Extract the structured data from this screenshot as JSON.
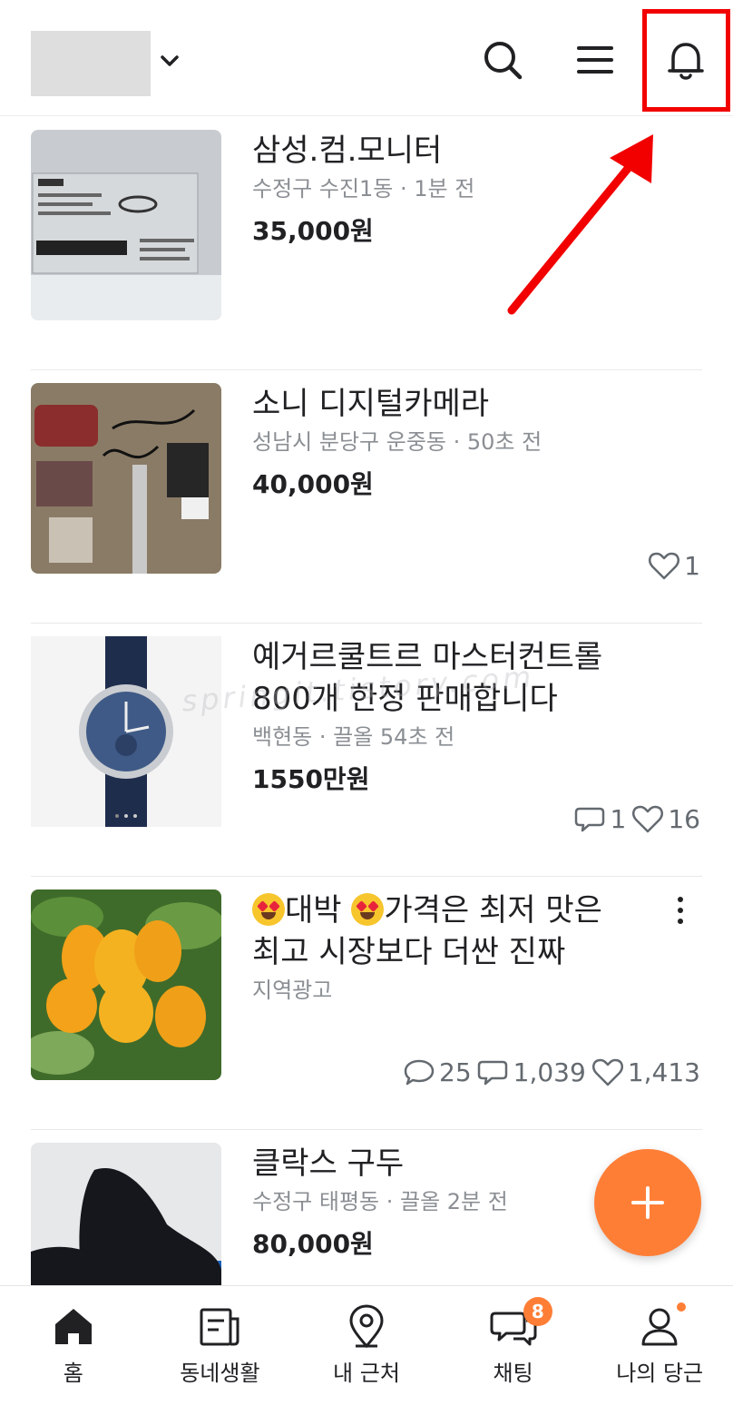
{
  "header": {
    "icons": [
      "chevron-down-icon",
      "search-icon",
      "menu-icon",
      "bell-icon"
    ]
  },
  "items": [
    {
      "title": "삼성.컴.모니터",
      "meta": "수정구 수진1동 · 1분 전",
      "price": "35,000원"
    },
    {
      "title": "소니 디지털카메라",
      "meta": "성남시 분당구 운중동 · 50초 전",
      "price": "40,000원",
      "likes": "1"
    },
    {
      "title_line1": "예거르쿨트르 마스터컨트롤",
      "title_line2": "800개 한정 판매합니다",
      "meta": "백현동 · 끌올 54초 전",
      "price": "1550만원",
      "chats": "1",
      "likes": "16"
    },
    {
      "title_part1": "대박 ",
      "title_part2": "가격은 최저 맛은",
      "title_line2": "최고 시장보다 더싼 진짜",
      "meta": "지역광고",
      "comments": "25",
      "chats": "1,039",
      "likes": "1,413"
    },
    {
      "title": "클락스 구두",
      "meta": "수정구 태평동 · 끌올 2분 전",
      "price": "80,000원"
    }
  ],
  "watermark": "springit.tistory.com",
  "nav": [
    {
      "label": "홈",
      "icon": "home-icon"
    },
    {
      "label": "동네생활",
      "icon": "neighborhood-icon"
    },
    {
      "label": "내 근처",
      "icon": "location-pin-icon"
    },
    {
      "label": "채팅",
      "icon": "chat-icon",
      "badge": "8"
    },
    {
      "label": "나의 당근",
      "icon": "profile-icon"
    }
  ],
  "colors": {
    "accent": "#ff7e36",
    "highlight": "#f20000",
    "text": "#212124",
    "subtext": "#8b8f94"
  }
}
